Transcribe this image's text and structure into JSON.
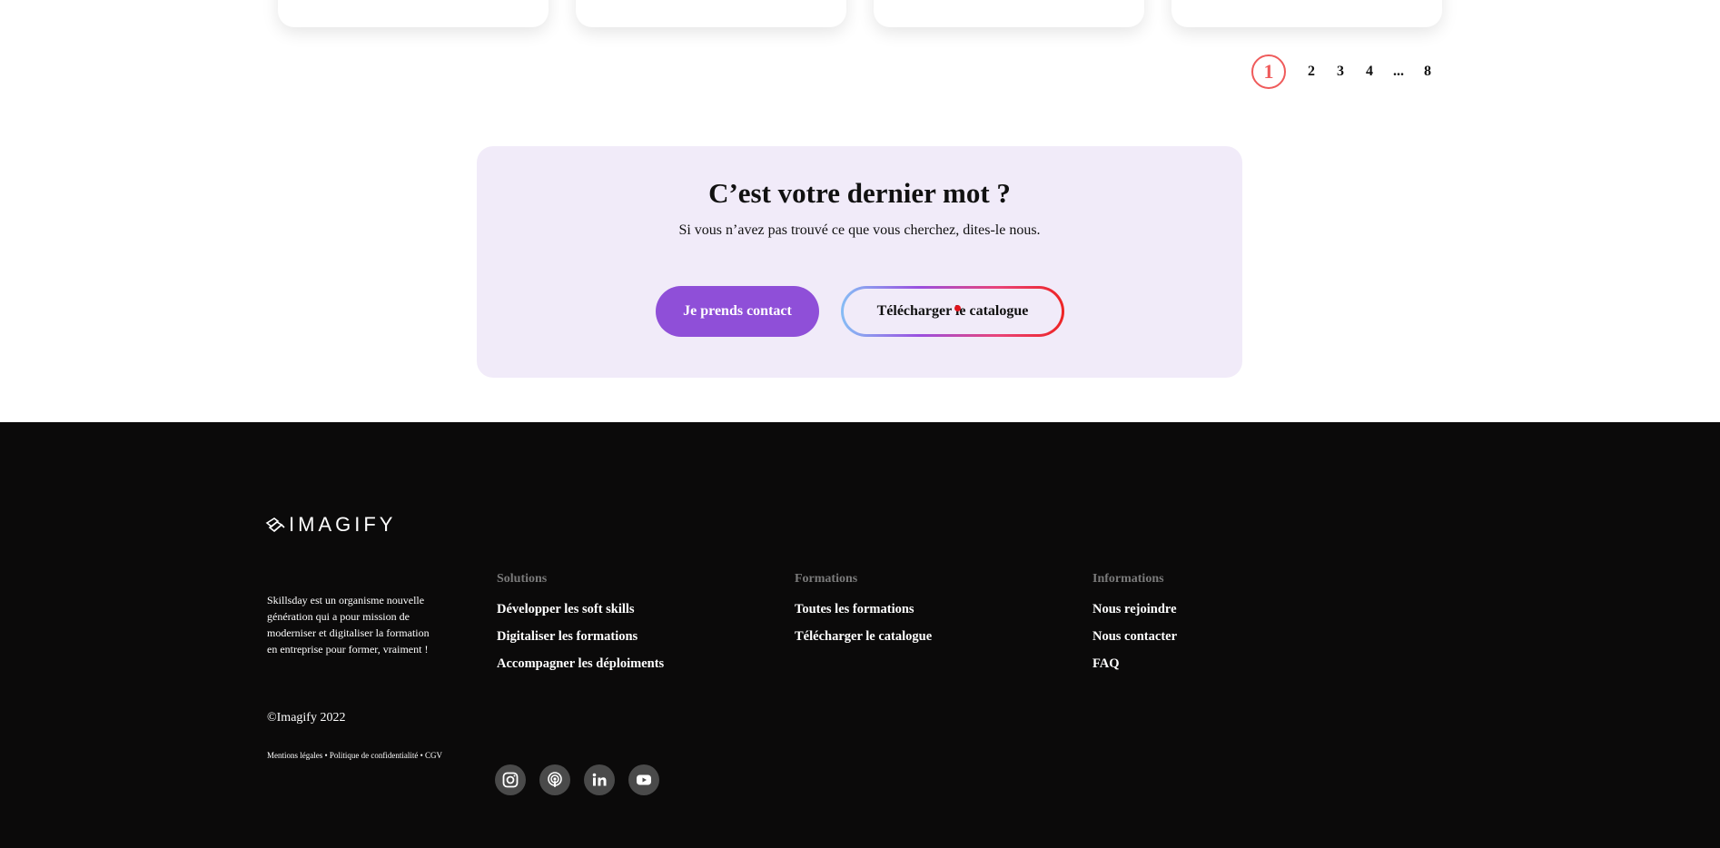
{
  "pagination": {
    "current": "1",
    "pages": [
      "2",
      "3",
      "4",
      "...",
      "8"
    ]
  },
  "cta": {
    "title": "C’est votre dernier mot ?",
    "subtitle": "Si vous n’avez pas trouvé ce que vous cherchez, dites-le nous.",
    "contact_button": "Je prends contact",
    "catalogue_button": "Télécharger le catalogue"
  },
  "footer": {
    "logo_text": "IMAGIFY",
    "about": "Skillsday est un organisme nouvelle génération qui a pour mission de moderniser et digitaliser la formation en entreprise pour former, vraiment !",
    "copyright": "©Imagify 2022",
    "legal": "Mentions légales • Politique de confidentialité • CGV",
    "columns": [
      {
        "title": "Solutions",
        "links": [
          "Développer les soft skills",
          "Digitaliser les formations",
          "Accompagner les déploiments"
        ]
      },
      {
        "title": "Formations",
        "links": [
          "Toutes les formations",
          "Télécharger le catalogue"
        ]
      },
      {
        "title": "Informations",
        "links": [
          "Nous rejoindre",
          "Nous contacter",
          "FAQ"
        ]
      }
    ],
    "socials": [
      "instagram-icon",
      "podcast-icon",
      "linkedin-icon",
      "youtube-icon"
    ]
  },
  "colors": {
    "accent_purple": "#8f4fd8",
    "pagination_red": "#ef5b5b",
    "cta_background": "#f1ebf9",
    "footer_background": "#0b0a0a"
  }
}
